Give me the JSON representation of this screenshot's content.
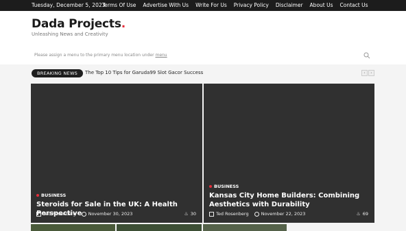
{
  "topbar": {
    "date": "Tuesday, December 5, 2023",
    "links": [
      "Terms Of Use",
      "Advertise With Us",
      "Write For Us",
      "Privacy Policy",
      "Disclaimer",
      "About Us",
      "Contact Us"
    ]
  },
  "header": {
    "logo": "Dada Projects",
    "logo_dot": ".",
    "tagline": "Unleashing News and Creativity",
    "menu_note": "Please assign a menu to the primary menu location under",
    "menu_link": "menu"
  },
  "breaking": {
    "label": "BREAKING NEWS",
    "headline": "The Top 10 Tips for Garuda99 Slot Gacor Success",
    "prev": "‹",
    "next": "›"
  },
  "cards": [
    {
      "category": "BUSINESS",
      "title": "Steroids for Sale in the UK: A Health Perspective",
      "author": "Ted Rosenberg",
      "date": "November 30, 2023",
      "views": "30"
    },
    {
      "category": "BUSINESS",
      "title": "Kansas City Home Builders: Combining Aesthetics with Durability",
      "author": "Ted Rosenberg",
      "date": "November 22, 2023",
      "views": "69"
    }
  ],
  "colors": {
    "accent": "#e52d3a",
    "dark": "#1c1c1c",
    "card": "#303030"
  }
}
